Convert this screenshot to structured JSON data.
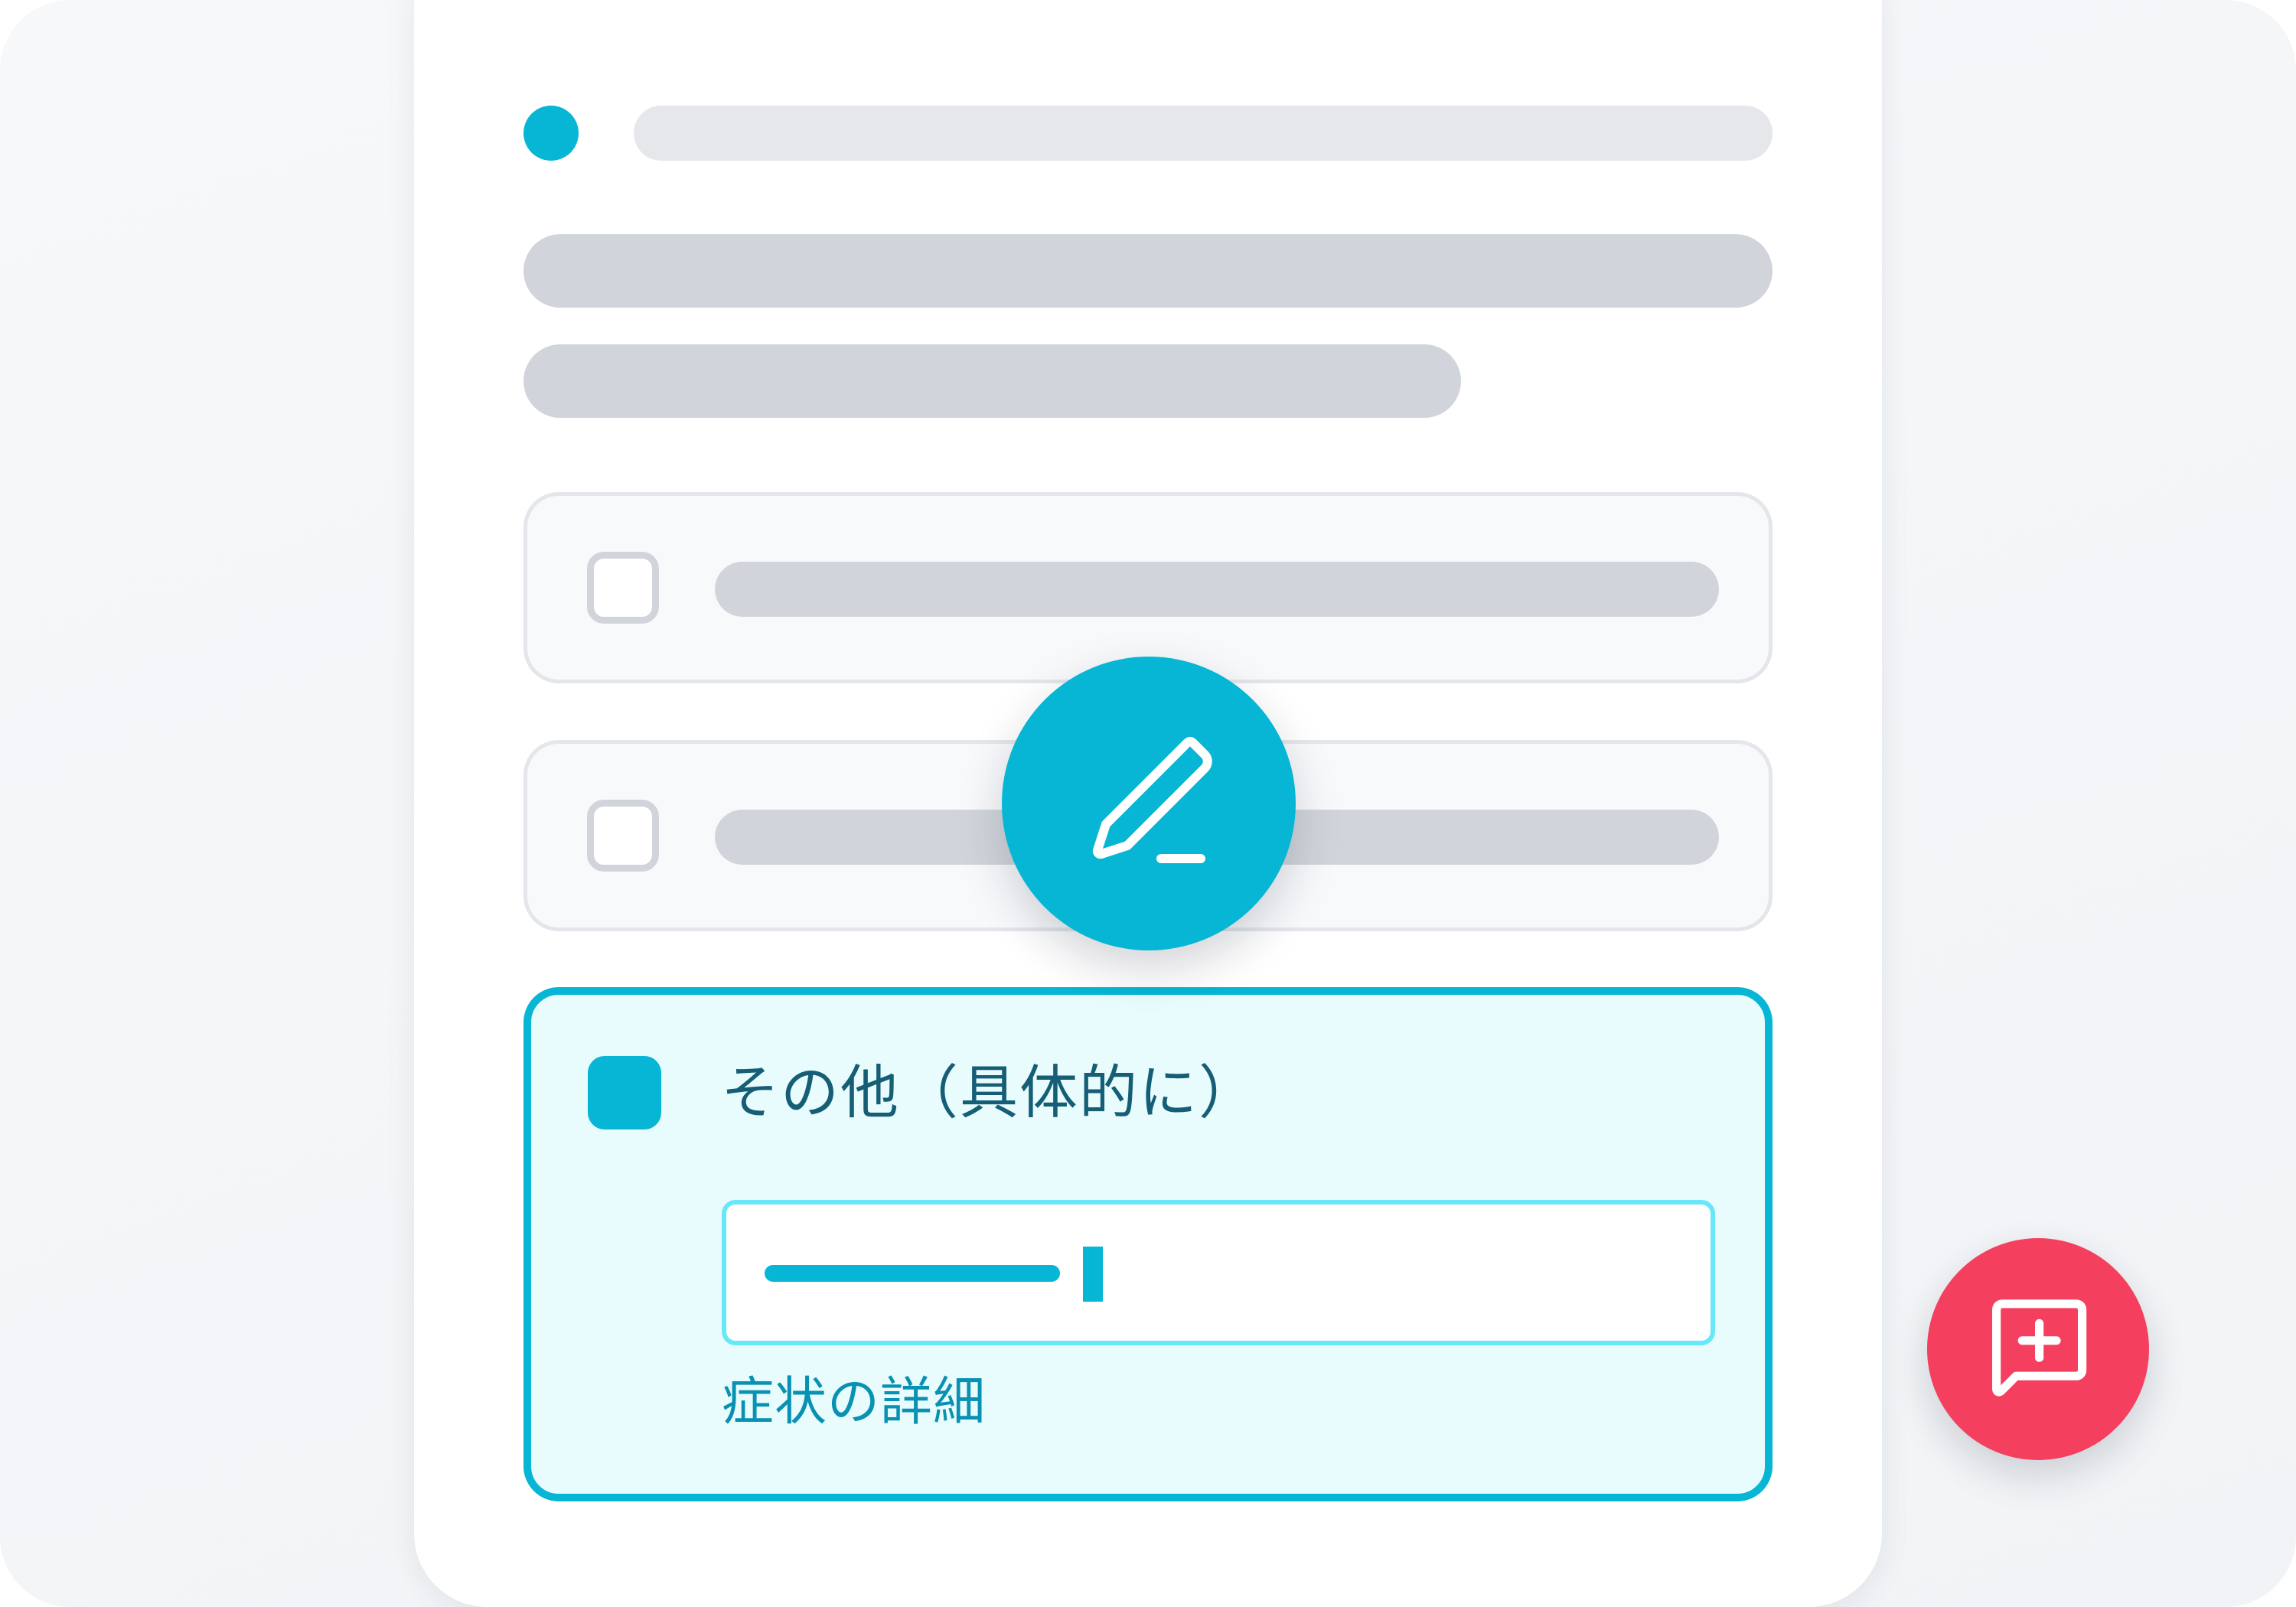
{
  "form": {
    "other_option": {
      "label": "その他（具体的に）",
      "checked": true,
      "detail_field": {
        "helper_text": "症状の詳細"
      }
    },
    "unchecked_options_count": 2
  },
  "actions": {
    "edit_icon": "pencil-icon",
    "feedback_icon": "message-plus-icon"
  },
  "colors": {
    "accent": "#06b6d4",
    "feedback": "#f43f5e",
    "skeleton": "#d1d5db"
  }
}
